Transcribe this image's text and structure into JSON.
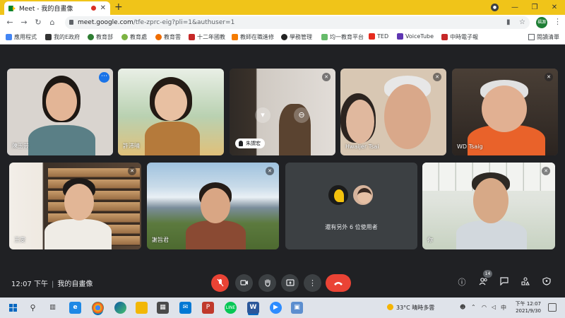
{
  "browser": {
    "tab_title": "Meet - 我的自畫像",
    "tab_close": "✕",
    "new_tab": "+",
    "window_controls": [
      "—",
      "❐",
      "✕"
    ],
    "url_host": "meet.google.com",
    "url_path": "/tfe-zprc-eig?pli=1&authuser=1",
    "profile_label": "福源",
    "bookmarks": [
      "應用程式",
      "我的E政府",
      "教育部",
      "教育處",
      "教育雲",
      "十二年國教",
      "教師在職進修",
      "學務管理",
      "均一教育平台",
      "TED",
      "VoiceTube",
      "中時電子報"
    ],
    "reading_list": "閱讀清單",
    "colors": {
      "tabstrip": "#f0c419"
    }
  },
  "participants": [
    {
      "name": "陳玉芸",
      "muted": false,
      "active_speaker": true
    },
    {
      "name": "許沛晴",
      "muted": false
    },
    {
      "name": "朱謂宏",
      "muted": true,
      "hand_raised": true
    },
    {
      "name": "Hwaijer Tsai",
      "muted": true
    },
    {
      "name": "WD Tsaig",
      "muted": true
    },
    {
      "name": "王雯",
      "muted": true
    },
    {
      "name": "謝旨君",
      "muted": true
    },
    {
      "name": "你",
      "muted": true
    }
  ],
  "others": {
    "text": "還有另外 6 位使用者"
  },
  "bottom_bar": {
    "time": "12:07 下午",
    "separator": "|",
    "meeting_name": "我的自畫像",
    "participant_count": "14",
    "icons": [
      "mic-off",
      "camera",
      "raise-hand",
      "present",
      "more",
      "leave-call",
      "info",
      "people",
      "chat",
      "activities",
      "host-controls"
    ]
  },
  "taskbar": {
    "weather": "33°C  晴時多雲",
    "ime": "中",
    "clock_time": "下午 12:07",
    "clock_date": "2021/9/30"
  }
}
